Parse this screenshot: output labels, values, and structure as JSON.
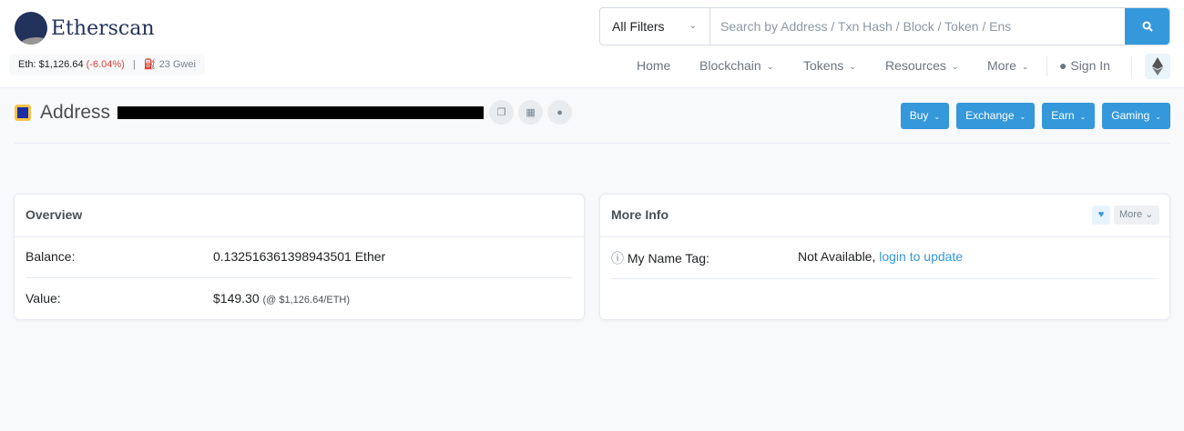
{
  "brand": {
    "name": "Etherscan"
  },
  "ticker": {
    "eth_label": "Eth: $1,126.64",
    "change": "(-6.04%)",
    "separator": "|",
    "gas": "23 Gwei"
  },
  "search": {
    "filter": "All Filters",
    "placeholder": "Search by Address / Txn Hash / Block / Token / Ens"
  },
  "nav": {
    "home": "Home",
    "blockchain": "Blockchain",
    "tokens": "Tokens",
    "resources": "Resources",
    "more": "More",
    "sign_in": "Sign In"
  },
  "page": {
    "title": "Address"
  },
  "actions": [
    "Buy",
    "Exchange",
    "Earn",
    "Gaming"
  ],
  "overview": {
    "title": "Overview",
    "balance_label": "Balance:",
    "balance": "0.132516361398943501 Ether",
    "value_label": "Value:",
    "value": "$149.30",
    "value_rate": "(@ $1,126.64/ETH)"
  },
  "more_info": {
    "title": "More Info",
    "more_button": "More",
    "name_tag_label": "My Name Tag:",
    "name_tag_value": "Not Available,",
    "login_link": "login to update"
  },
  "colors": {
    "accent": "#3498db",
    "negative": "#de4437",
    "brand": "#21325b"
  }
}
